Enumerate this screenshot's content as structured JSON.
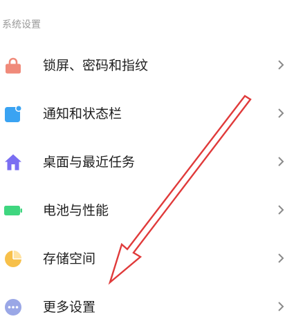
{
  "section": {
    "title": "系统设置"
  },
  "items": [
    {
      "label": "锁屏、密码和指纹",
      "icon": "lock-icon",
      "color": "#f08a7a"
    },
    {
      "label": "通知和状态栏",
      "icon": "notification-icon",
      "color": "#3aa3f2"
    },
    {
      "label": "桌面与最近任务",
      "icon": "home-icon",
      "color": "#7a6ef2"
    },
    {
      "label": "电池与性能",
      "icon": "battery-icon",
      "color": "#3fd67f"
    },
    {
      "label": "存储空间",
      "icon": "storage-pie-icon",
      "color": "#f7c04a"
    },
    {
      "label": "更多设置",
      "icon": "more-icon",
      "color": "#9aa7e6"
    }
  ],
  "annotation": {
    "arrow_color": "#e03a3a"
  }
}
